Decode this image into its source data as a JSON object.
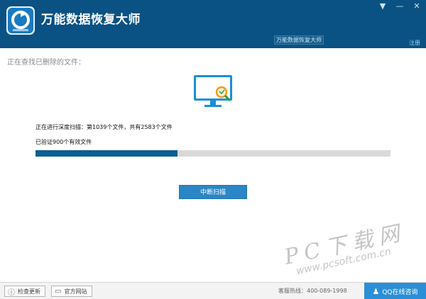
{
  "window": {
    "title": "万能数据恢复大师",
    "caption_overlay": "万能数据恢复大师",
    "controls": {
      "menu": "▼",
      "minimize": "—",
      "close": "✕"
    },
    "register_label": "注册"
  },
  "scan": {
    "status_title": "正在查找已删除的文件：",
    "progress_text": "正在进行深度扫描：第1039个文件，共有2583个文件",
    "verified_text": "已验证900个有效文件",
    "progress_fraction": 0.4,
    "stop_button_label": "中断扫描"
  },
  "watermark": {
    "big": "PC下载网",
    "small": "www.pcsoft.com.cn"
  },
  "footer": {
    "check_update_label": "检查更新",
    "website_label": "官方网站",
    "hotline": "客服热线：400-089-1998",
    "qq_label": "QQ在线咨询"
  },
  "colors": {
    "titlebar": "#0a5283",
    "progress_fill": "#0c5e93",
    "button": "#2a86c6",
    "qq": "#2b8fd8"
  }
}
